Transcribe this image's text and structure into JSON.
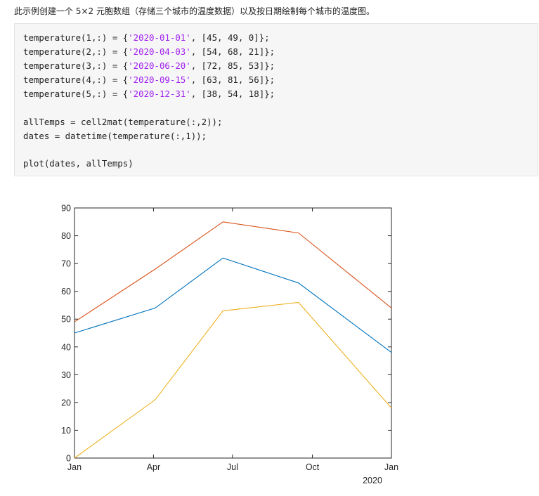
{
  "intro_text": "此示例创建一个 5×2 元胞数组（存储三个城市的温度数据）以及按日期绘制每个城市的温度图。",
  "code": {
    "lines": [
      {
        "parts": [
          {
            "t": "temperature(1,:) = {"
          },
          {
            "t": "'2020-01-01'",
            "s": true
          },
          {
            "t": ", [45, 49, 0]};"
          }
        ]
      },
      {
        "parts": [
          {
            "t": "temperature(2,:) = {"
          },
          {
            "t": "'2020-04-03'",
            "s": true
          },
          {
            "t": ", [54, 68, 21]};"
          }
        ]
      },
      {
        "parts": [
          {
            "t": "temperature(3,:) = {"
          },
          {
            "t": "'2020-06-20'",
            "s": true
          },
          {
            "t": ", [72, 85, 53]};"
          }
        ]
      },
      {
        "parts": [
          {
            "t": "temperature(4,:) = {"
          },
          {
            "t": "'2020-09-15'",
            "s": true
          },
          {
            "t": ", [63, 81, 56]};"
          }
        ]
      },
      {
        "parts": [
          {
            "t": "temperature(5,:) = {"
          },
          {
            "t": "'2020-12-31'",
            "s": true
          },
          {
            "t": ", [38, 54, 18]};"
          }
        ]
      },
      {
        "parts": []
      },
      {
        "parts": [
          {
            "t": "allTemps = cell2mat(temperature(:,2));"
          }
        ]
      },
      {
        "parts": [
          {
            "t": "dates = datetime(temperature(:,1));"
          }
        ]
      },
      {
        "parts": []
      },
      {
        "parts": [
          {
            "t": "plot(dates, allTemps)"
          }
        ]
      }
    ]
  },
  "chart_data": {
    "type": "line",
    "title": "",
    "xlabel": "",
    "ylabel": "",
    "x": [
      "2020-01-01",
      "2020-04-03",
      "2020-06-20",
      "2020-09-15",
      "2020-12-31"
    ],
    "series": [
      {
        "color": "#0072BD",
        "values": [
          45,
          54,
          72,
          63,
          38
        ]
      },
      {
        "color": "#D95319",
        "values": [
          49,
          68,
          85,
          81,
          54
        ]
      },
      {
        "color": "#EDB120",
        "values": [
          0,
          21,
          53,
          56,
          18
        ]
      }
    ],
    "ylim": [
      0,
      90
    ],
    "xlim": [
      "2020-01-01",
      "2020-12-31"
    ],
    "y_ticks": [
      0,
      10,
      20,
      30,
      40,
      50,
      60,
      70,
      80,
      90
    ],
    "x_ticks": [
      {
        "date": "2020-01-01",
        "label": "Jan"
      },
      {
        "date": "2020-04-01",
        "label": "Apr"
      },
      {
        "date": "2020-07-01",
        "label": "Jul"
      },
      {
        "date": "2020-10-01",
        "label": "Oct"
      },
      {
        "date": "2020-12-31",
        "label": "Jan"
      }
    ],
    "x_secondary_label": "2020",
    "grid": false,
    "legend": "none"
  }
}
